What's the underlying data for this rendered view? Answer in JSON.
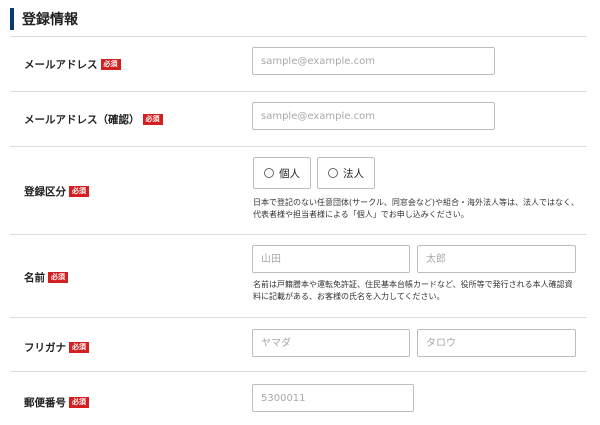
{
  "section": {
    "title": "登録情報"
  },
  "required_badge": "必須",
  "fields": {
    "email": {
      "label": "メールアドレス",
      "placeholder": "sample@example.com"
    },
    "email_confirm": {
      "label": "メールアドレス（確認）",
      "placeholder": "sample@example.com"
    },
    "registration_type": {
      "label": "登録区分",
      "options": [
        {
          "label": "個人",
          "selected": false
        },
        {
          "label": "法人",
          "selected": false
        }
      ],
      "note": "日本で登記のない任意団体(サークル、同窓会など)や組合・海外法人等は、法人ではなく、代表者様や担当者様による「個人」でお申し込みください。"
    },
    "name": {
      "label": "名前",
      "last_placeholder": "山田",
      "first_placeholder": "太郎",
      "note": "名前は戸籍謄本や運転免許証、住民基本台帳カードなど、役所等で発行される本人確認資料に記載がある、お客様の氏名を入力してください。"
    },
    "furigana": {
      "label": "フリガナ",
      "last_placeholder": "ヤマダ",
      "first_placeholder": "タロウ"
    },
    "postal_code": {
      "label": "郵便番号",
      "placeholder": "5300011"
    }
  },
  "colors": {
    "accent_bar": "#0b3a6e",
    "required_badge": "#d31f1f",
    "border": "#bdbdbd"
  }
}
